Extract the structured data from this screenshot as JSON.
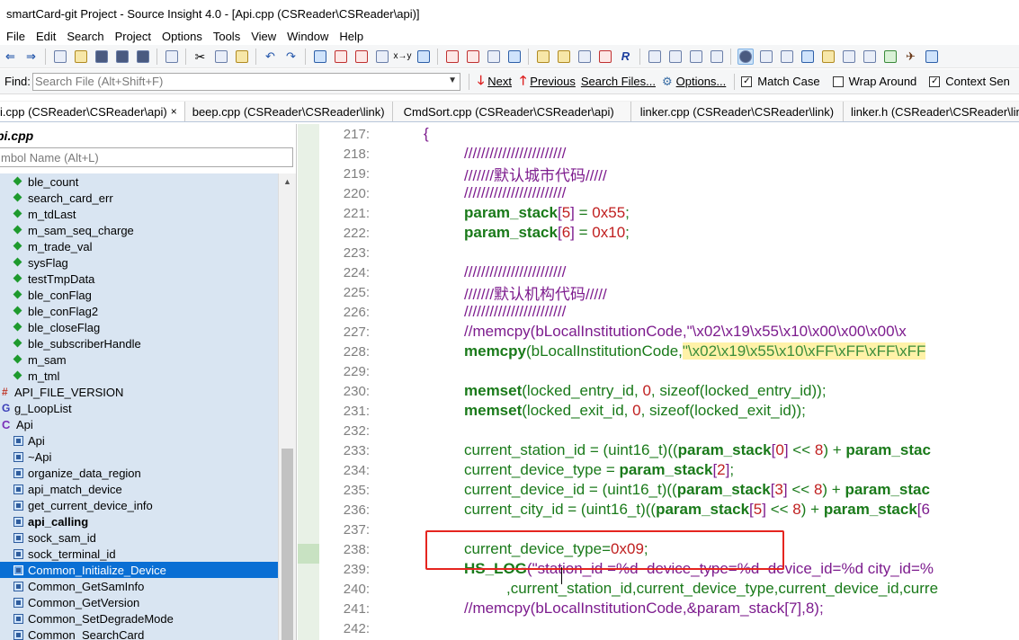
{
  "window": {
    "title": "smartCard-git Project - Source Insight 4.0 - [Api.cpp (CSReader\\CSReader\\api)]"
  },
  "menu": [
    "File",
    "Edit",
    "Search",
    "Project",
    "Options",
    "Tools",
    "View",
    "Window",
    "Help"
  ],
  "findbar": {
    "label": "Find:",
    "placeholder": "Search File (Alt+Shift+F)",
    "next_label": "Next",
    "previous_label": "Previous",
    "search_files_label": "Search Files...",
    "options_label": "Options...",
    "match_case": {
      "label": "Match Case",
      "checked": true
    },
    "wrap_around": {
      "label": "Wrap Around",
      "checked": false
    },
    "context_sensitive": {
      "label": "Context Sen",
      "checked": true
    }
  },
  "tabs": [
    {
      "label": "i.cpp (CSReader\\CSReader\\api)",
      "active": true
    },
    {
      "label": "beep.cpp (CSReader\\CSReader\\link)",
      "active": false
    },
    {
      "label": "CmdSort.cpp (CSReader\\CSReader\\api)",
      "active": false
    },
    {
      "label": "linker.cpp (CSReader\\CSReader\\link)",
      "active": false
    },
    {
      "label": "linker.h (CSReader\\CSReader\\link)",
      "active": false
    }
  ],
  "symbol_panel": {
    "title": "pi.cpp",
    "search_placeholder": "mbol Name (Alt+L)",
    "items": [
      {
        "label": "ble_count",
        "kind": "var"
      },
      {
        "label": "search_card_err",
        "kind": "var"
      },
      {
        "label": "m_tdLast",
        "kind": "var"
      },
      {
        "label": "m_sam_seq_charge",
        "kind": "var"
      },
      {
        "label": "m_trade_val",
        "kind": "var"
      },
      {
        "label": "sysFlag",
        "kind": "var"
      },
      {
        "label": "testTmpData",
        "kind": "var"
      },
      {
        "label": "ble_conFlag",
        "kind": "var"
      },
      {
        "label": "ble_conFlag2",
        "kind": "var"
      },
      {
        "label": "ble_closeFlag",
        "kind": "var"
      },
      {
        "label": "ble_subscriberHandle",
        "kind": "var"
      },
      {
        "label": "m_sam",
        "kind": "var"
      },
      {
        "label": "m_tml",
        "kind": "var"
      },
      {
        "label": "API_FILE_VERSION",
        "kind": "define"
      },
      {
        "label": "g_LoopList",
        "kind": "global"
      },
      {
        "label": "Api",
        "kind": "class"
      },
      {
        "label": "Api",
        "kind": "fn"
      },
      {
        "label": "~Api",
        "kind": "fn"
      },
      {
        "label": "organize_data_region",
        "kind": "fn"
      },
      {
        "label": "api_match_device",
        "kind": "fn"
      },
      {
        "label": "get_current_device_info",
        "kind": "fn"
      },
      {
        "label": "api_calling",
        "kind": "fn",
        "bold": true
      },
      {
        "label": "sock_sam_id",
        "kind": "fn"
      },
      {
        "label": "sock_terminal_id",
        "kind": "fn"
      },
      {
        "label": "Common_Initialize_Device",
        "kind": "fn",
        "selected": true
      },
      {
        "label": "Common_GetSamInfo",
        "kind": "fn"
      },
      {
        "label": "Common_GetVersion",
        "kind": "fn"
      },
      {
        "label": "Common_SetDegradeMode",
        "kind": "fn"
      },
      {
        "label": "Common_SearchCard",
        "kind": "fn"
      }
    ]
  },
  "editor": {
    "line_numbers": [
      "217:",
      "218:",
      "219:",
      "220:",
      "221:",
      "222:",
      "223:",
      "224:",
      "225:",
      "226:",
      "227:",
      "228:",
      "229:",
      "230:",
      "231:",
      "232:",
      "233:",
      "234:",
      "235:",
      "236:",
      "237:",
      "238:",
      "239:",
      "240:",
      "241:",
      "242:"
    ],
    "code": {
      "l217": "{",
      "l218": "////////////////////////",
      "l219": "///////默认城市代码/////",
      "l220": "////////////////////////",
      "l221a": "param_stack",
      "l221b": "[",
      "l221c": "5",
      "l221d": "]",
      "l221e": " = ",
      "l221f": "0x55",
      "l221g": ";",
      "l222a": "param_stack",
      "l222b": "[",
      "l222c": "6",
      "l222d": "]",
      "l222e": " = ",
      "l222f": "0x10",
      "l222g": ";",
      "l224": "////////////////////////",
      "l225": "///////默认机构代码/////",
      "l226": "////////////////////////",
      "l227": "//memcpy(bLocalInstitutionCode,\"\\x02\\x19\\x55\\x10\\x00\\x00\\x00\\x",
      "l228a": "memcpy",
      "l228b": "(bLocalInstitutionCode,",
      "l228c": "\"\\x02\\x19\\x55\\x10\\xFF\\xFF\\xFF\\xFF",
      "l230a": "memset",
      "l230b": "(locked_entry_id, ",
      "l230c": "0",
      "l230d": ", sizeof(locked_entry_id));",
      "l231a": "memset",
      "l231b": "(locked_exit_id, ",
      "l231c": "0",
      "l231d": ", sizeof(locked_exit_id));",
      "l233a": "current_station_id = (uint16_t)((",
      "l233b": "param_stack",
      "l233c": "[",
      "l233d": "0",
      "l233e": "]",
      "l233f": " << ",
      "l233g": "8",
      "l233h": ") + ",
      "l233i": "param_stac",
      "l234a": "current_device_type = ",
      "l234b": "param_stack",
      "l234c": "[",
      "l234d": "2",
      "l234e": "]",
      "l234f": ";",
      "l235a": "current_device_id = (uint16_t)((",
      "l235b": "param_stack",
      "l235c": "[",
      "l235d": "3",
      "l235e": "]",
      "l235f": " << ",
      "l235g": "8",
      "l235h": ") + ",
      "l235i": "param_stac",
      "l236a": "current_city_id = (uint16_t)((",
      "l236b": "param_stack",
      "l236c": "[",
      "l236d": "5",
      "l236e": "]",
      "l236f": " << ",
      "l236g": "8",
      "l236h": ") + ",
      "l236i": "param_stack",
      "l236j": "[6",
      "l238a": "current_device_type=",
      "l238b": "0x09",
      "l238c": ";",
      "l239a": "HS_LOG",
      "l239b": "(\"station_id =%d  device_type=%d  device_id=%d city_id=%",
      "l240": ",current_station_id,current_device_type,current_device_id,curre",
      "l241": "//memcpy(bLocalInstitutionCode,&param_stack[7],8);"
    }
  }
}
